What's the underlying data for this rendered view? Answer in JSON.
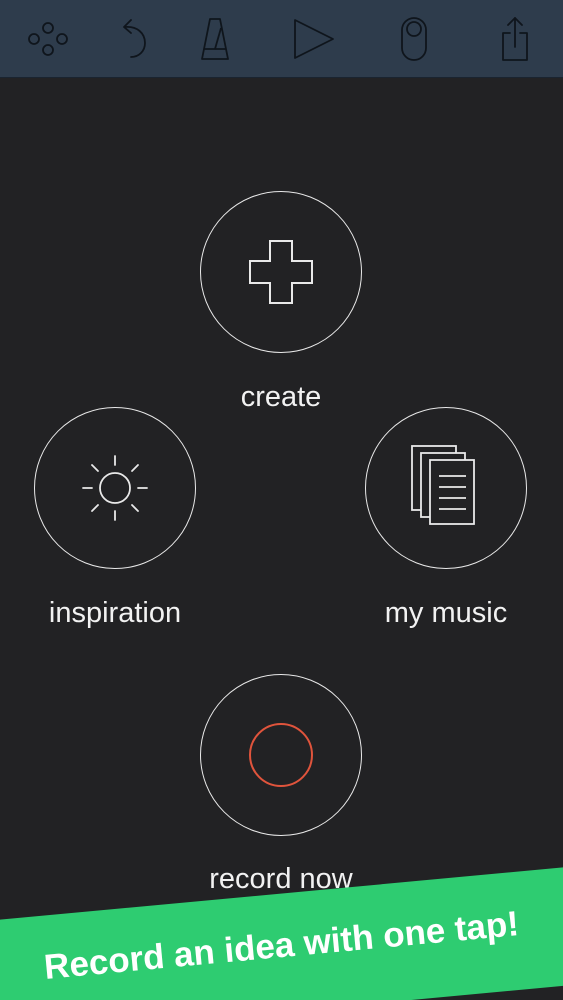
{
  "colors": {
    "background": "#222224",
    "toolbar": "#2e3c4c",
    "toolbar_icon": "#0f151c",
    "outline": "#e9e9e9",
    "record_accent": "#e0543c",
    "banner": "#2ecc71"
  },
  "toolbar": {
    "icons": [
      "dots-icon",
      "undo-icon",
      "metronome-icon",
      "play-icon",
      "toggle-icon",
      "share-icon"
    ]
  },
  "main": {
    "create_label": "create",
    "inspiration_label": "inspiration",
    "my_music_label": "my music",
    "record_label": "record now"
  },
  "banner": {
    "text": "Record an idea with one tap!"
  }
}
